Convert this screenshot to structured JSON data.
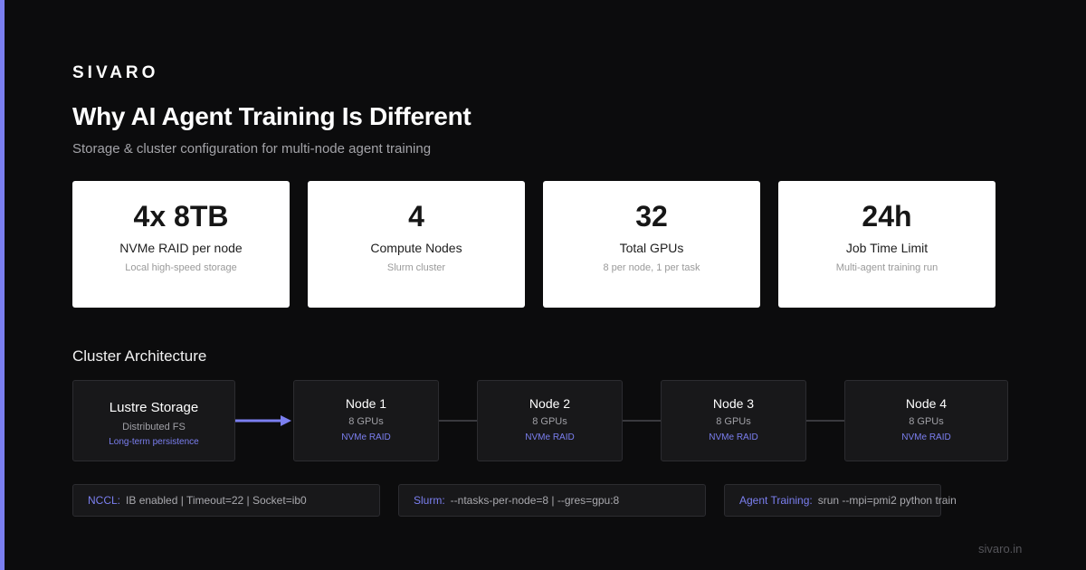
{
  "brand": "SIVARO",
  "title": "Why AI Agent Training Is Different",
  "subtitle": "Storage & cluster configuration for multi-node agent training",
  "stats": [
    {
      "value": "4x 8TB",
      "label": "NVMe RAID per node",
      "sub": "Local high-speed storage"
    },
    {
      "value": "4",
      "label": "Compute Nodes",
      "sub": "Slurm cluster"
    },
    {
      "value": "32",
      "label": "Total GPUs",
      "sub": "8 per node, 1 per task"
    },
    {
      "value": "24h",
      "label": "Job Time Limit",
      "sub": "Multi-agent training run"
    }
  ],
  "architecture": {
    "title": "Cluster Architecture",
    "storage": {
      "title": "Lustre Storage",
      "sub": "Distributed FS",
      "accent": "Long-term persistence"
    },
    "nodes": [
      {
        "title": "Node 1",
        "gpus": "8 GPUs",
        "storage": "NVMe RAID"
      },
      {
        "title": "Node 2",
        "gpus": "8 GPUs",
        "storage": "NVMe RAID"
      },
      {
        "title": "Node 3",
        "gpus": "8 GPUs",
        "storage": "NVMe RAID"
      },
      {
        "title": "Node 4",
        "gpus": "8 GPUs",
        "storage": "NVMe RAID"
      }
    ]
  },
  "info": [
    {
      "key": "NCCL:",
      "value": "IB enabled | Timeout=22 | Socket=ib0"
    },
    {
      "key": "Slurm:",
      "value": "--ntasks-per-node=8 | --gres=gpu:8"
    },
    {
      "key": "Agent Training:",
      "value": "srun --mpi=pmi2 python train"
    }
  ],
  "footer": "sivaro.in",
  "colors": {
    "accent": "#7b7ff0",
    "background": "#0c0c0d",
    "card": "#ffffff",
    "box": "#18181a"
  }
}
